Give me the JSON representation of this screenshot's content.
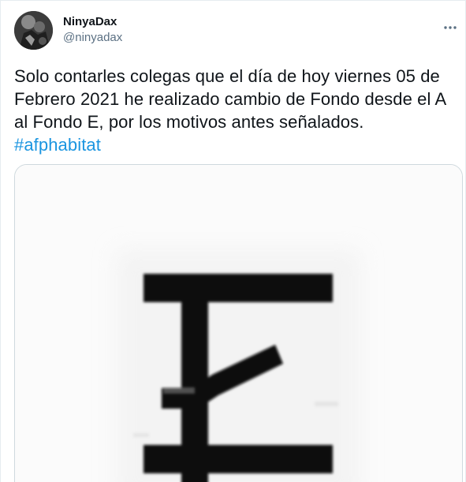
{
  "tweet": {
    "author": {
      "display_name": "NinyaDax",
      "handle": "@ninyadax"
    },
    "more_icon": "more-horizontal-icon",
    "text_lines": [
      "Solo contarles colegas que el día de hoy viernes 05 de",
      "Febrero 2021 he realizado cambio de Fondo desde el A",
      "al Fondo E, por los motivos antes señalados."
    ],
    "hashtag": "#afphabitat",
    "media": {
      "letter": "E"
    }
  },
  "colors": {
    "text": "#0f1419",
    "secondary": "#5b7083",
    "link": "#1b95e0",
    "border": "#cfd9de"
  }
}
